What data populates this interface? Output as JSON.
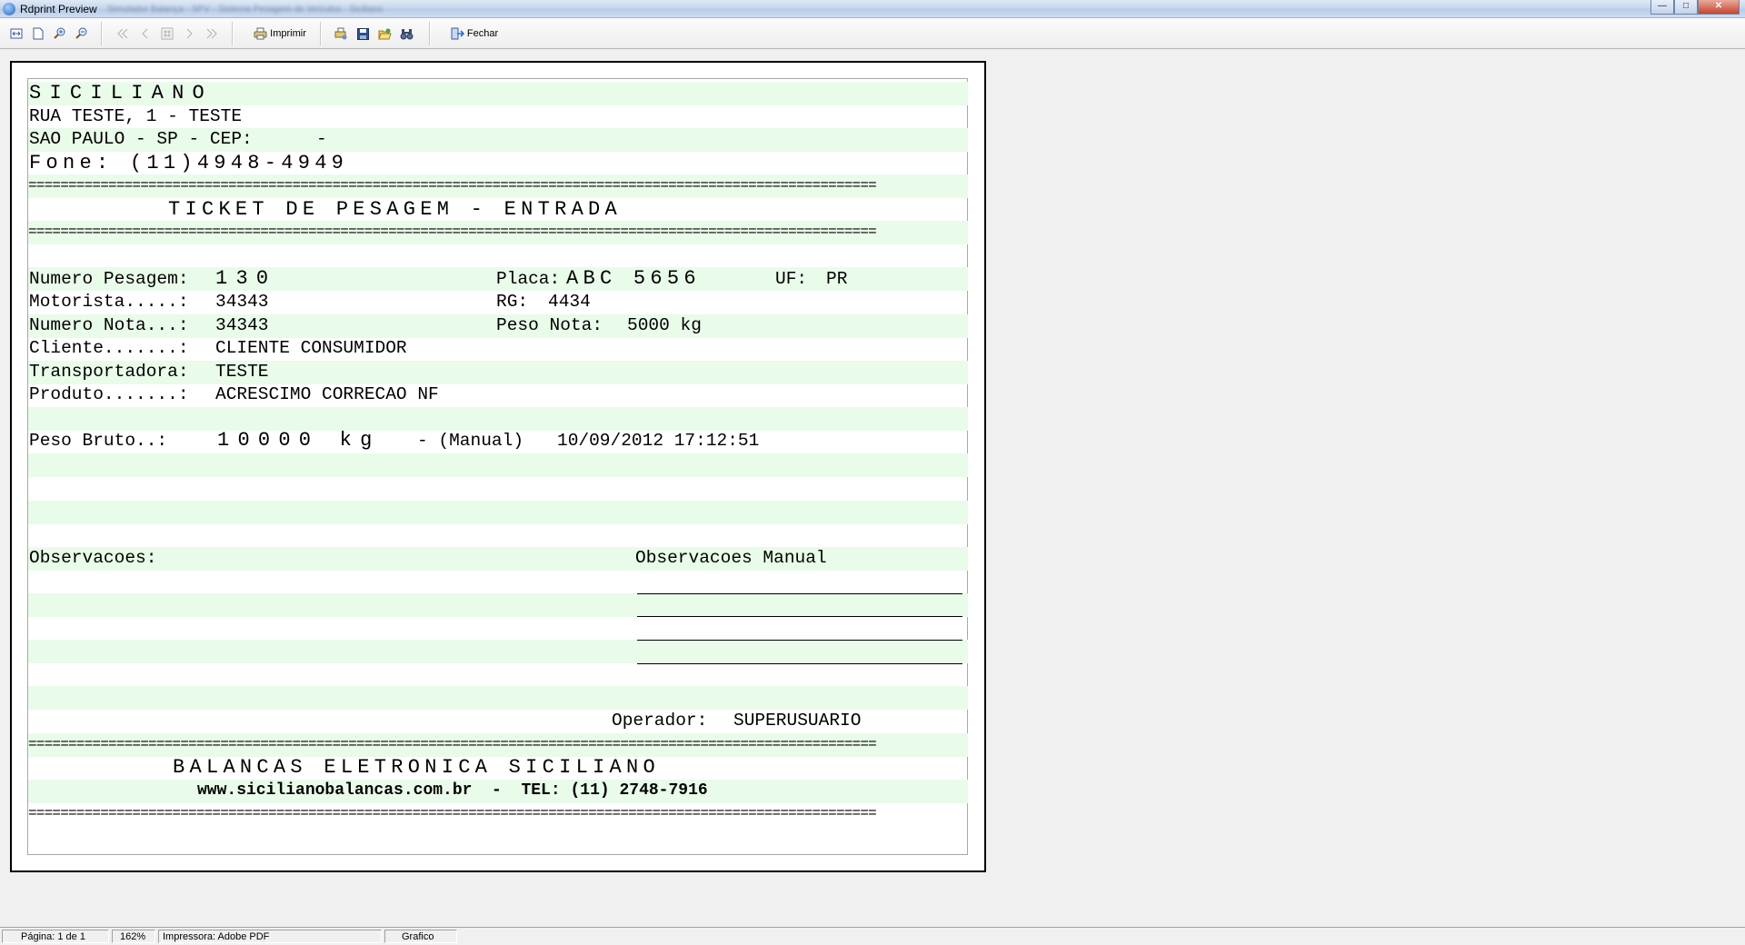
{
  "window": {
    "title": "Rdprint Preview",
    "blurred_title": "Simulador Balança - SPV - Sistema Pesagem de Veículos - Siciliano",
    "btn_minimize": "—",
    "btn_maximize": "□",
    "btn_close": "✕"
  },
  "toolbar": {
    "print_label": "Imprimir",
    "close_label": "Fechar"
  },
  "ticket": {
    "company": "SICILIANO",
    "address": "RUA TESTE, 1 - TESTE",
    "city": "SAO PAULO - SP - CEP:      -",
    "phone": "Fone: (11)4948-4949",
    "separator": "==========================================================================================================",
    "ticket_title": "TICKET DE PESAGEM - ENTRADA",
    "weighing_number_label": "Numero Pesagem:",
    "weighing_number": "130",
    "plate_label": "Placa:",
    "plate": "ABC 5656",
    "uf_label": "UF:",
    "uf": "PR",
    "driver_label": "Motorista.....:",
    "driver": "34343",
    "rg_label": "RG:",
    "rg": "4434",
    "invoice_label": "Numero Nota...:",
    "invoice": "34343",
    "invoice_weight_label": "Peso Nota:",
    "invoice_weight": "5000 kg",
    "client_label": "Cliente.......:",
    "client": "CLIENTE CONSUMIDOR",
    "carrier_label": "Transportadora:",
    "carrier": "TESTE",
    "product_label": "Produto.......:",
    "product": "ACRESCIMO CORRECAO NF",
    "gross_label": "Peso Bruto..:",
    "gross_value": "10000 kg",
    "gross_mode": "- (Manual)",
    "gross_datetime": "10/09/2012 17:12:51",
    "obs_label": "Observacoes:",
    "obs_manual_label": "Observacoes Manual",
    "operator_label": "Operador:",
    "operator": "SUPERUSUARIO",
    "footer_company": "BALANCAS ELETRONICA SICILIANO",
    "footer_contact": "www.sicilianobalancas.com.br  -  TEL: (11) 2748-7916"
  },
  "status": {
    "page": "Página: 1 de 1",
    "zoom": "162%",
    "printer": "Impressora: Adobe PDF",
    "mode": "Grafico"
  }
}
